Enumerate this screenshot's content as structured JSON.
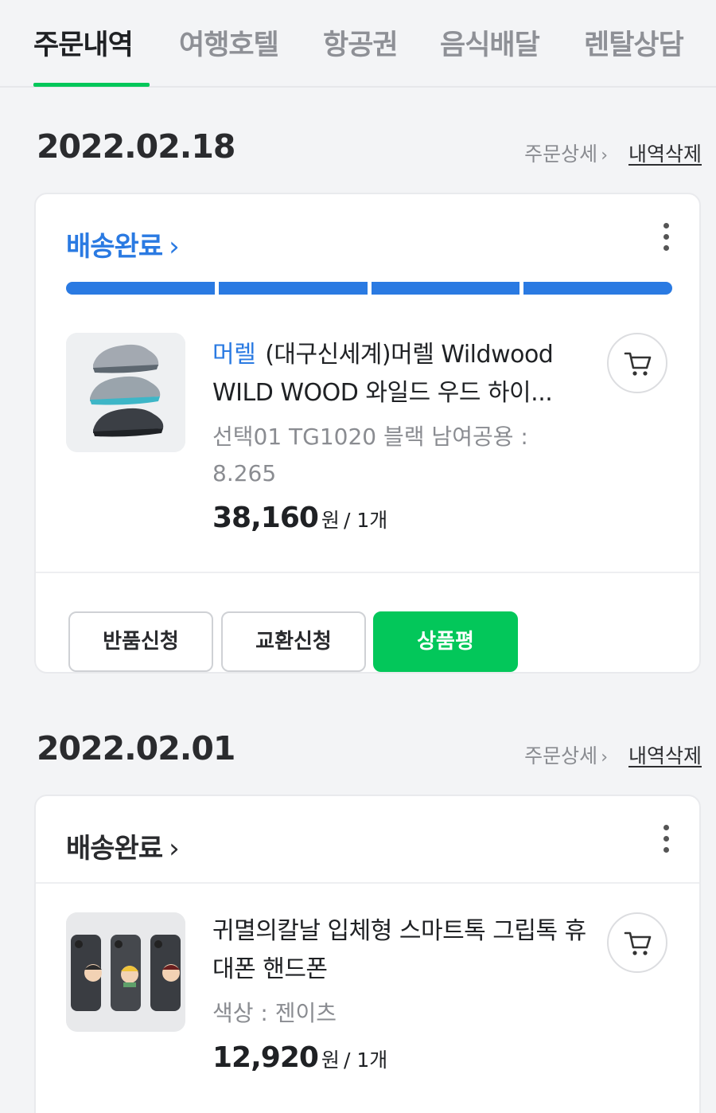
{
  "tabs": [
    {
      "label": "주문내역",
      "active": true
    },
    {
      "label": "여행호텔",
      "active": false
    },
    {
      "label": "항공권",
      "active": false
    },
    {
      "label": "음식배달",
      "active": false
    },
    {
      "label": "렌탈상담",
      "active": false
    }
  ],
  "orders": [
    {
      "date": "2022.02.18",
      "detail_label": "주문상세",
      "delete_label": "내역삭제",
      "status": "배송완료",
      "progress_steps": 4,
      "progress_completed": 4,
      "product": {
        "brand": "머렐",
        "title": "(대구신세계)머렐 Wildwood WILD WOOD 와일드 우드 하이...",
        "option": "선택01 TG1020 블랙 남여공용 : 8.265",
        "price": "38,160",
        "currency": "원",
        "quantity": "/ 1개"
      },
      "buttons": {
        "return": "반품신청",
        "exchange": "교환신청",
        "review": "상품평"
      }
    },
    {
      "date": "2022.02.01",
      "detail_label": "주문상세",
      "delete_label": "내역삭제",
      "status": "배송완료",
      "product": {
        "title": "귀멸의칼날 입체형 스마트톡 그립톡 휴대폰 핸드폰",
        "option": "색상 : 젠이츠",
        "price": "12,920",
        "currency": "원",
        "quantity": "/ 1개"
      }
    }
  ],
  "colors": {
    "accent_green": "#03c75a",
    "status_blue": "#2a7ae2"
  }
}
